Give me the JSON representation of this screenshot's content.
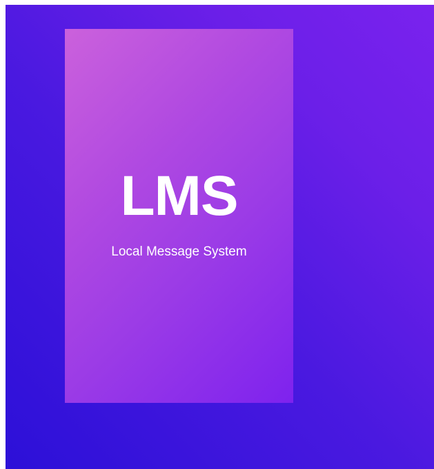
{
  "brand": {
    "title": "LMS",
    "subtitle": "Local Message System"
  },
  "colors": {
    "background_start": "#2c10d8",
    "background_end": "#7a22ee",
    "card_start": "#cb61dc",
    "card_end": "#7e22ee",
    "text": "#ffffff"
  }
}
